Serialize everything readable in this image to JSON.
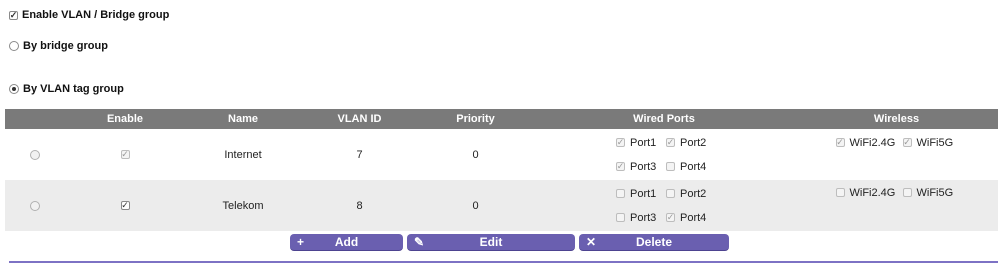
{
  "options": {
    "enable_label": "Enable VLAN / Bridge group",
    "enable_checked": true,
    "bridge_label": "By bridge group",
    "bridge_selected": false,
    "vlan_label": "By VLAN tag group",
    "vlan_selected": true
  },
  "table": {
    "headers": [
      "Enable",
      "Name",
      "VLAN ID",
      "Priority",
      "Wired Ports",
      "Wireless"
    ],
    "rows": [
      {
        "enable": true,
        "name": "Internet",
        "vlan_id": "7",
        "priority": "0",
        "ports": [
          {
            "label": "Port1",
            "checked": true
          },
          {
            "label": "Port2",
            "checked": true
          },
          {
            "label": "Port3",
            "checked": true
          },
          {
            "label": "Port4",
            "checked": false
          }
        ],
        "wireless": [
          {
            "label": "WiFi2.4G",
            "checked": true
          },
          {
            "label": "WiFi5G",
            "checked": true
          }
        ]
      },
      {
        "enable": true,
        "name": "Telekom",
        "vlan_id": "8",
        "priority": "0",
        "ports": [
          {
            "label": "Port1",
            "checked": false
          },
          {
            "label": "Port2",
            "checked": false
          },
          {
            "label": "Port3",
            "checked": false
          },
          {
            "label": "Port4",
            "checked": true
          }
        ],
        "wireless": [
          {
            "label": "WiFi2.4G",
            "checked": false
          },
          {
            "label": "WiFi5G",
            "checked": false
          }
        ]
      }
    ]
  },
  "buttons": {
    "add_label": "Add",
    "edit_label": "Edit",
    "delete_label": "Delete"
  },
  "colors": {
    "button": "#6a5fb0",
    "header": "#7a7a7a",
    "divider": "#7d72c4"
  }
}
